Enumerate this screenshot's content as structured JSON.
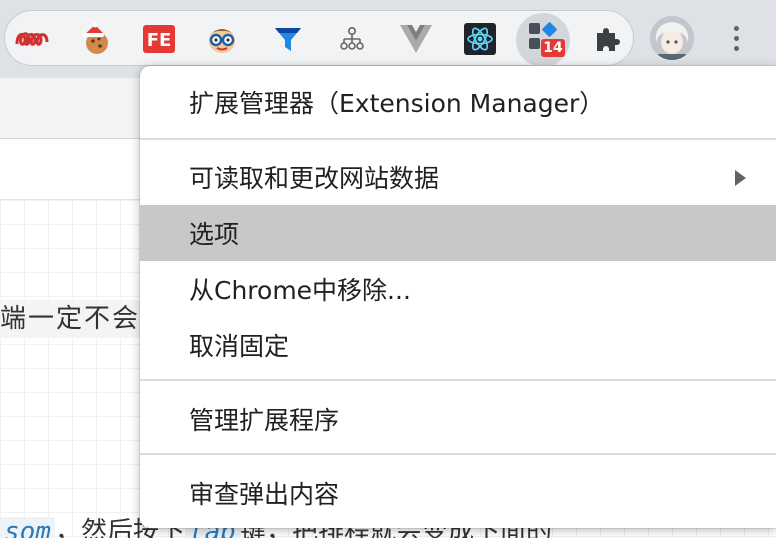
{
  "toolbar": {
    "extensions": [
      {
        "name": "extension-1-icon"
      },
      {
        "name": "cookie-extension-icon"
      },
      {
        "name": "fe-extension-icon",
        "label": "FE"
      },
      {
        "name": "face-extension-icon"
      },
      {
        "name": "funnel-extension-icon"
      },
      {
        "name": "sitemap-extension-icon"
      },
      {
        "name": "vue-devtools-icon"
      },
      {
        "name": "react-devtools-icon"
      },
      {
        "name": "extension-manager-icon",
        "badge": "14"
      },
      {
        "name": "puzzle-extensions-icon"
      }
    ],
    "avatar": "profile-avatar",
    "menu": "more-menu-icon"
  },
  "background": {
    "text_fragment": "端一定不会",
    "bottom_code": "som",
    "bottom_text": "，然后按下",
    "bottom_code2": "tab",
    "bottom_text2": "键，把排程就会变成下面的"
  },
  "context_menu": {
    "title": "扩展管理器（Extension Manager）",
    "items": [
      {
        "label": "可读取和更改网站数据",
        "submenu": true
      },
      {
        "label": "选项",
        "highlighted": true
      },
      {
        "label": "从Chrome中移除..."
      },
      {
        "label": "取消固定"
      },
      {
        "label": "管理扩展程序"
      },
      {
        "label": "审查弹出内容"
      }
    ]
  },
  "colors": {
    "highlight": "#c8c8c8",
    "badge": "#e53935"
  }
}
